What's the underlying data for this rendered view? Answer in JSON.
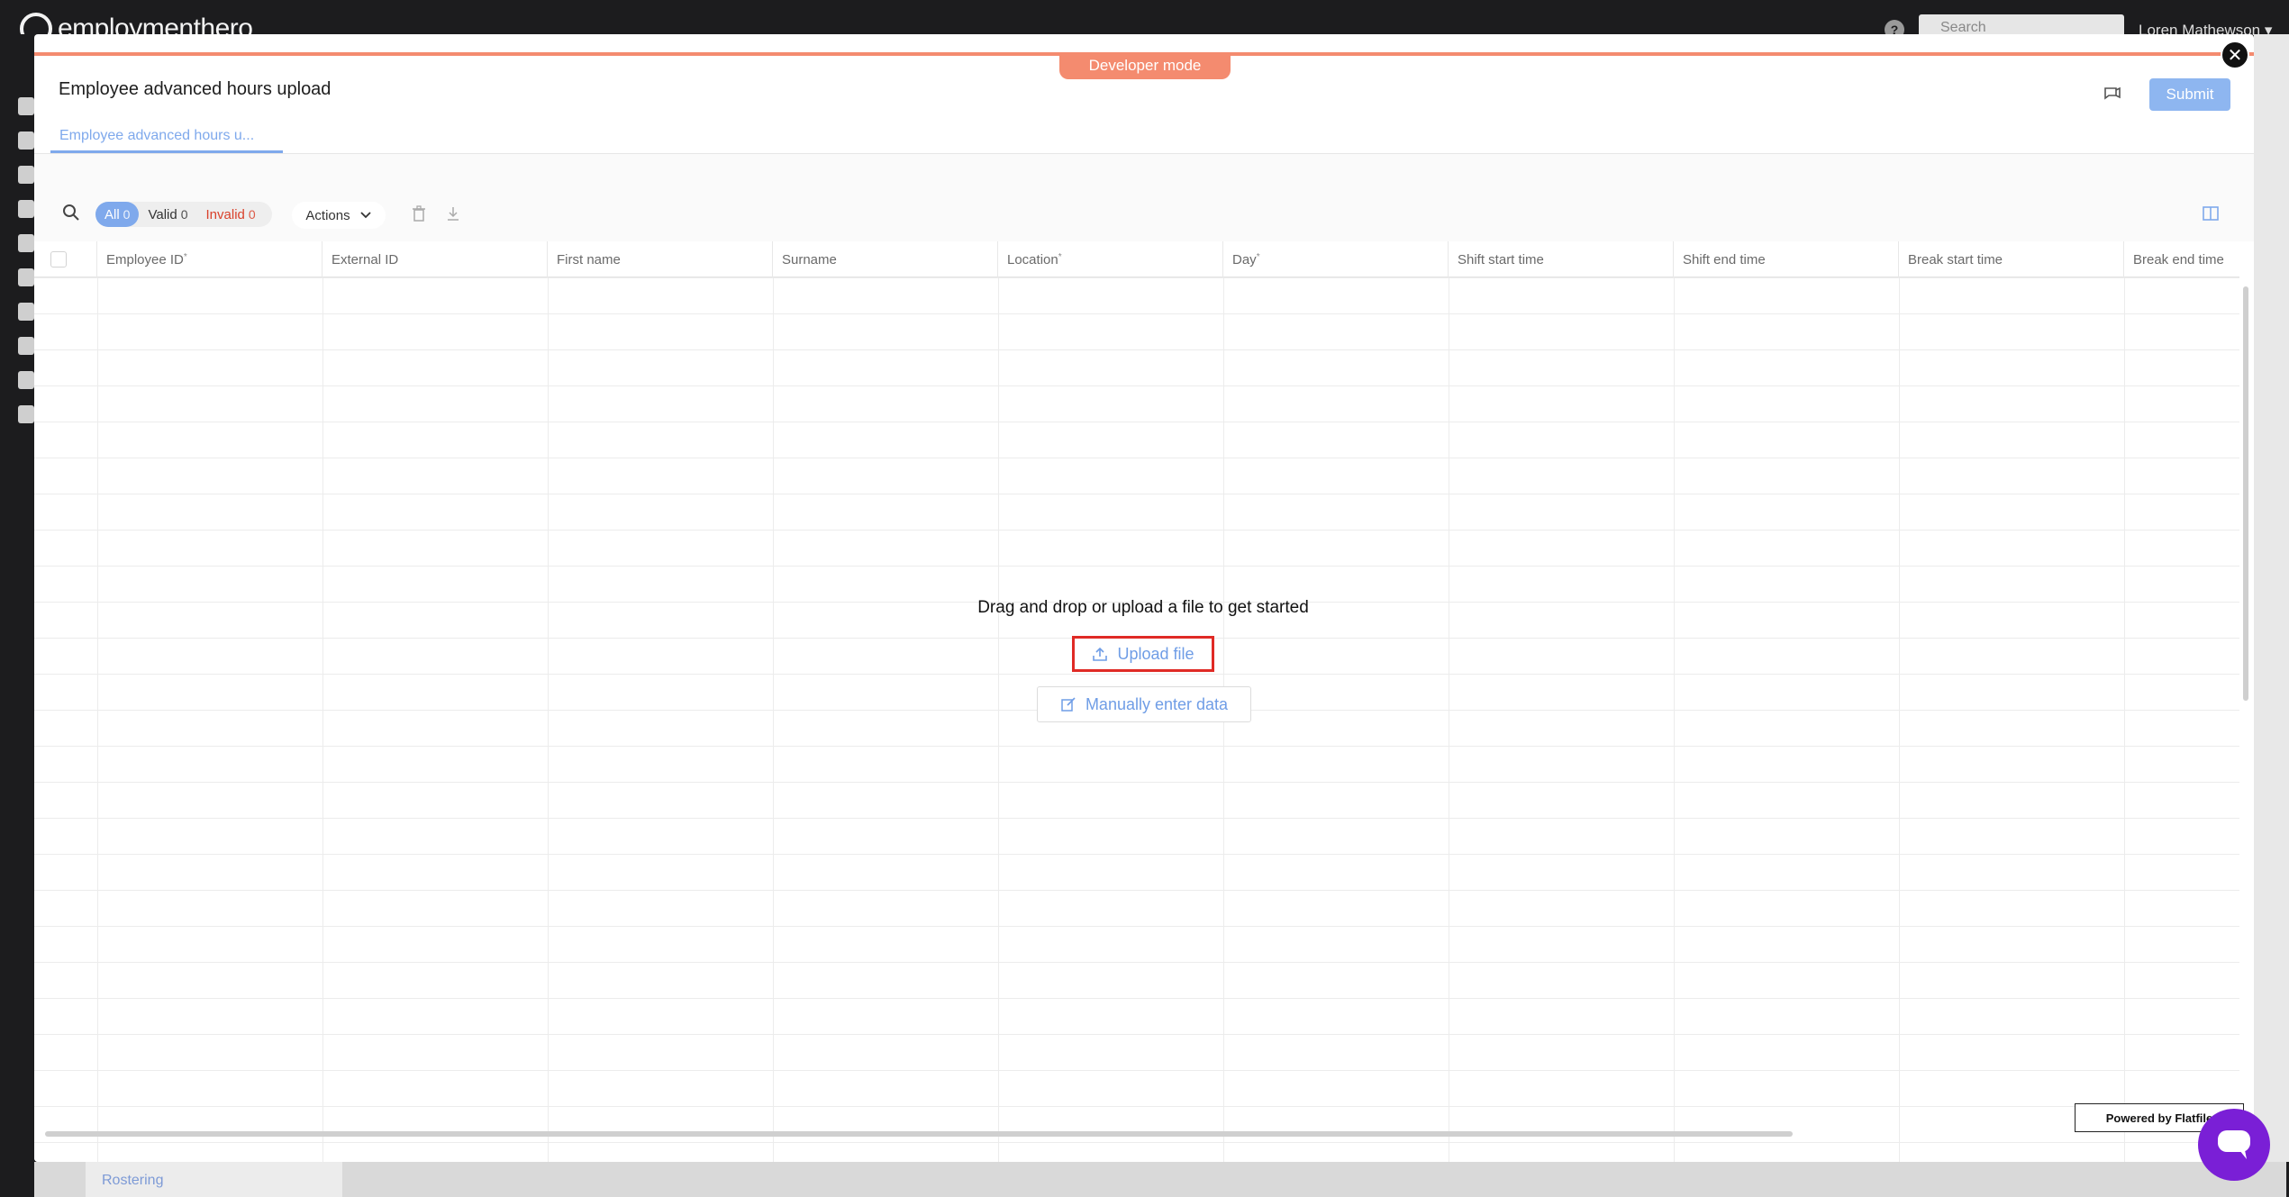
{
  "app": {
    "logo_text": "employmenthero",
    "search_placeholder": "Search",
    "user_name": "Loren Mathewson ▾",
    "bottom_item": "Rostering"
  },
  "modal": {
    "developer_mode": "Developer mode",
    "title": "Employee advanced hours upload",
    "submit_label": "Submit",
    "sheet_tab": "Employee advanced hours u...",
    "close_glyph": "✕"
  },
  "toolbar": {
    "filters": {
      "all_label": "All",
      "all_count": "0",
      "valid_label": "Valid",
      "valid_count": "0",
      "invalid_label": "Invalid",
      "invalid_count": "0"
    },
    "actions_label": "Actions"
  },
  "grid": {
    "columns": [
      {
        "label": "Employee ID",
        "required": "*"
      },
      {
        "label": "External ID",
        "required": ""
      },
      {
        "label": "First name",
        "required": ""
      },
      {
        "label": "Surname",
        "required": ""
      },
      {
        "label": "Location",
        "required": "*"
      },
      {
        "label": "Day",
        "required": "*"
      },
      {
        "label": "Shift start time",
        "required": ""
      },
      {
        "label": "Shift end time",
        "required": ""
      },
      {
        "label": "Break start time",
        "required": ""
      },
      {
        "label": "Break end time",
        "required": ""
      }
    ],
    "empty_message": "Drag and drop or upload a file to get started",
    "upload_label": "Upload file",
    "manual_label": "Manually enter data"
  },
  "footer": {
    "powered_by": "Powered by Flatfile"
  },
  "colors": {
    "accent": "#7fa9ec",
    "developer_mode": "#f48b6f",
    "invalid": "#d9412b",
    "highlight_border": "#e02a25",
    "chat": "#7a1fd6"
  },
  "icons": [
    "search-icon",
    "trash-icon",
    "download-icon",
    "columns-icon",
    "upload-icon",
    "edit-icon",
    "feedback-icon",
    "close-icon",
    "chat-icon",
    "chevron-down-icon"
  ]
}
